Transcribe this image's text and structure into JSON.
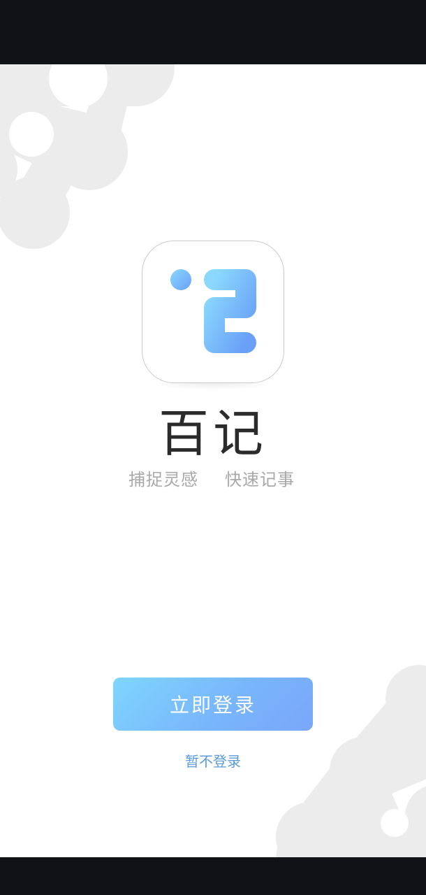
{
  "app": {
    "name": "百记",
    "slogan_left": "捕捉灵感",
    "slogan_right": "快速记事"
  },
  "actions": {
    "login_label": "立即登录",
    "skip_label": "暂不登录"
  },
  "icons": {
    "logo": "dots-ji-logo",
    "decor": "gray-blob-decoration"
  },
  "colors": {
    "status_bar": "#101216",
    "button_gradient_start": "#7fd6ff",
    "button_gradient_end": "#7aa6fa",
    "skip_link": "#5b9bd8",
    "decor_blob": "#ececec",
    "app_name": "#2b2b2b",
    "slogan": "#a8a8a8"
  }
}
